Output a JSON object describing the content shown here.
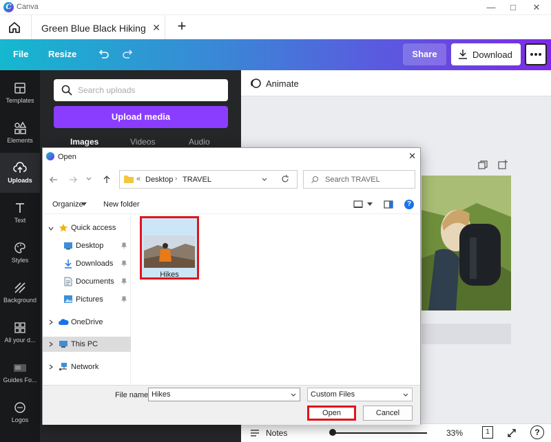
{
  "window": {
    "title": "Canva",
    "controls": [
      "minimize-icon",
      "maximize-icon",
      "close-icon"
    ]
  },
  "tabs": {
    "active_label": "Green Blue Black Hiking Fitness",
    "new_tab_symbol": "+",
    "close_symbol": "✕"
  },
  "toolbar": {
    "file_label": "File",
    "resize_label": "Resize",
    "share_label": "Share",
    "download_label": "Download",
    "gradient": [
      "#15b8cf",
      "#7d2ae8"
    ]
  },
  "rail": {
    "items": [
      {
        "label": "Templates"
      },
      {
        "label": "Elements"
      },
      {
        "label": "Uploads"
      },
      {
        "label": "Text"
      },
      {
        "label": "Styles"
      },
      {
        "label": "Background"
      },
      {
        "label": "All your d..."
      },
      {
        "label": "Guides Fo..."
      },
      {
        "label": "Logos"
      }
    ]
  },
  "panel": {
    "search_placeholder": "Search uploads",
    "upload_button": "Upload media",
    "tabs": [
      "Images",
      "Videos",
      "Audio"
    ],
    "accent": "#8b3dff"
  },
  "editor": {
    "animate_label": "Animate",
    "notes_label": "Notes",
    "zoom": "33%",
    "page_number": "1",
    "help": "?"
  },
  "dialog": {
    "title": "Open",
    "path": [
      "Desktop",
      "TRAVEL"
    ],
    "path_prefix": "«",
    "search_placeholder": "Search TRAVEL",
    "organize_label": "Organize",
    "new_folder_label": "New folder",
    "nav": {
      "quick_access": "Quick access",
      "pinned": [
        "Desktop",
        "Downloads",
        "Documents",
        "Pictures"
      ],
      "onedrive": "OneDrive",
      "this_pc": "This PC",
      "network": "Network"
    },
    "file": {
      "name": "Hikes"
    },
    "file_name_label": "File name:",
    "file_name_value": "Hikes",
    "filter_value": "Custom Files",
    "open_label": "Open",
    "cancel_label": "Cancel",
    "highlight_color": "#e0141c"
  }
}
